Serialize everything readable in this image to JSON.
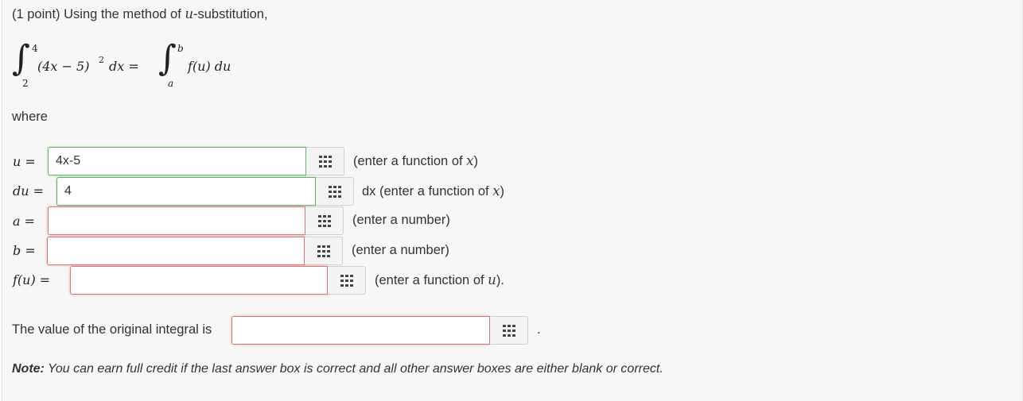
{
  "problem": {
    "header": "(1 point) Using the method of ",
    "header_var": "u",
    "header_tail": "-substitution,",
    "integral": {
      "lower1": "2",
      "upper1": "4",
      "integrand": "(4x − 5)",
      "power": "2",
      "dx": "dx =",
      "lower2": "a",
      "upper2": "b",
      "integrand2": "f(u) du"
    },
    "where": "where"
  },
  "rows": [
    {
      "label": "u =",
      "value": "4x-5",
      "hint_pre": "(enter a function of ",
      "hint_var": "x",
      "hint_post": ")"
    },
    {
      "label": "du =",
      "value": "4",
      "hint_pre": "dx (enter a function of ",
      "hint_var": "x",
      "hint_post": ")"
    },
    {
      "label": "a =",
      "value": "",
      "hint_pre": "(enter a number)",
      "hint_var": "",
      "hint_post": ""
    },
    {
      "label": "b =",
      "value": "",
      "hint_pre": "(enter a number)",
      "hint_var": "",
      "hint_post": ""
    },
    {
      "label": "f(u) =",
      "value": "",
      "hint_pre": "(enter a function of ",
      "hint_var": "u",
      "hint_post": ")."
    }
  ],
  "final": {
    "label": "The value of the original integral is",
    "value": "",
    "period": "."
  },
  "note": {
    "bold": "Note:",
    "text": " You can earn full credit if the last answer box is correct and all other answer boxes are either blank or correct."
  },
  "icons": {
    "grid": "grid-icon"
  },
  "colors": {
    "correct": "#5cb85c",
    "wrong": "#d9534f",
    "panel": "#f7f7f7"
  }
}
